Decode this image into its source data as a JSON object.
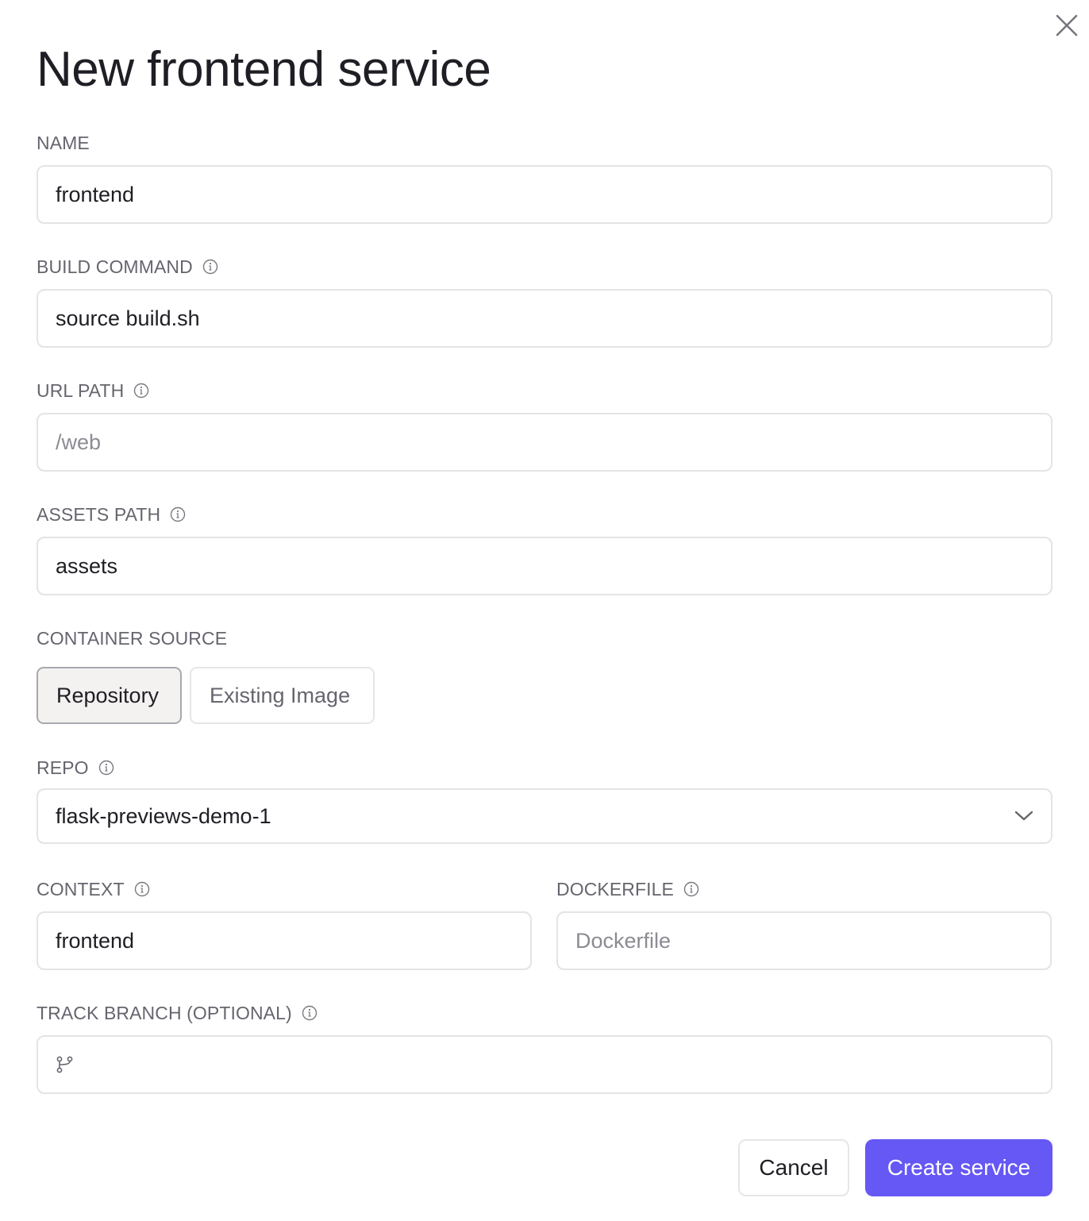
{
  "dialog": {
    "title": "New frontend service",
    "close_icon": "close-icon"
  },
  "fields": {
    "name": {
      "label": "NAME",
      "value": "frontend"
    },
    "build_command": {
      "label": "BUILD COMMAND",
      "value": "source build.sh",
      "info_icon": "info-icon"
    },
    "url_path": {
      "label": "URL PATH",
      "value": "",
      "placeholder": "/web",
      "info_icon": "info-icon"
    },
    "assets_path": {
      "label": "ASSETS PATH",
      "value": "assets",
      "info_icon": "info-icon"
    },
    "container_source": {
      "label": "CONTAINER SOURCE",
      "options": [
        {
          "label": "Repository",
          "selected": true
        },
        {
          "label": "Existing Image",
          "selected": false
        }
      ]
    },
    "repo": {
      "label": "REPO",
      "value": "flask-previews-demo-1",
      "info_icon": "info-icon",
      "dropdown_icon": "chevron-down-icon"
    },
    "context": {
      "label": "CONTEXT",
      "value": "frontend",
      "info_icon": "info-icon"
    },
    "dockerfile": {
      "label": "DOCKERFILE",
      "value": "",
      "placeholder": "Dockerfile",
      "info_icon": "info-icon"
    },
    "track_branch": {
      "label": "TRACK BRANCH (OPTIONAL)",
      "value": "",
      "info_icon": "info-icon",
      "leading_icon": "git-branch-icon"
    }
  },
  "actions": {
    "cancel_label": "Cancel",
    "create_label": "Create service"
  },
  "colors": {
    "primary": "#6558f5",
    "text": "#1f1e24",
    "label": "#66656e",
    "border": "#e4e4e6"
  }
}
